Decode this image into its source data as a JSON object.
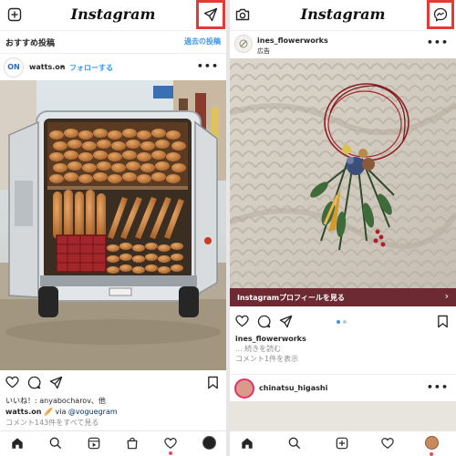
{
  "left": {
    "app_title": "Instagram",
    "suggested_label": "おすすめ投稿",
    "past_posts_link": "過去の投稿",
    "post": {
      "username": "watts.on",
      "follow": "フォローする",
      "avatar_text": "ON",
      "likes_line": "いいね！: anyabocharov、他",
      "caption_user": "watts.on",
      "caption_emoji": "🥖",
      "caption_via": "via",
      "caption_mention": "@voguegram",
      "comments_link": "コメント143件をすべて見る"
    }
  },
  "right": {
    "app_title": "Instagram",
    "post": {
      "username": "ines_flowerworks",
      "sponsored": "広告",
      "cta": "Instagramプロフィールを見る",
      "caption_user": "ines_flowerworks",
      "caption_more": "... 続きを読む",
      "comments_link": "コメント1件を表示"
    },
    "next_post": {
      "username": "chinatsu_higashi"
    }
  },
  "colors": {
    "highlight": "#e53935",
    "link_blue": "#3897f0",
    "cta_bar": "#6e2a33",
    "notification_dot": "#ed4956"
  }
}
